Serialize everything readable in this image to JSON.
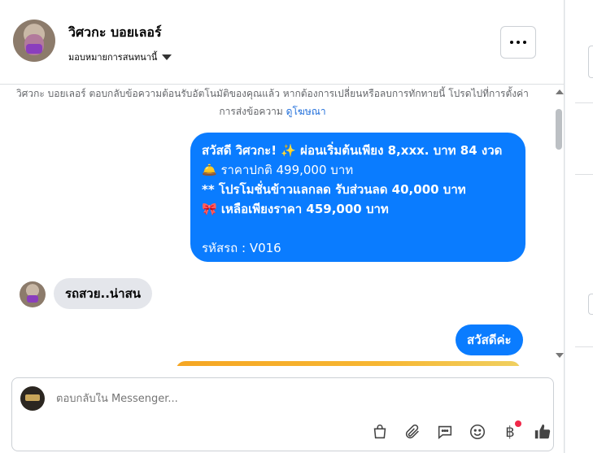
{
  "header": {
    "name": "วิศวกะ บอยเลอร์",
    "assign_label": "มอบหมายการสนทนานี้",
    "more_icon": "more-dots-icon"
  },
  "notice": {
    "text": "วิศวกะ บอยเลอร์ ตอบกลับข้อความต้อนรับอัตโนมัติของคุณแล้ว หากต้องการเปลี่ยนหรือลบการทักทายนี้ โปรดไปที่การตั้งค่าการส่งข้อความ",
    "link": "ดูโฆษณา"
  },
  "messages": {
    "outgoing_1": {
      "line1": "สวัสดี วิศวกะ! ✨  ผ่อนเริ่มต้นเพียง 8,xxx. บาท 84 งวด",
      "line2": "🛎️ ราคาปกติ 499,000 บาท",
      "line3": "** โปรโมชั่นข้าวแลกลด รับส่วนลด 40,000 บาท",
      "line4": "🎀  เหลือเพียงราคา 459,000 บาท",
      "line5": "",
      "line6": "รหัสรถ : V016"
    },
    "incoming_1": "รถสวย..น่าสน",
    "outgoing_2": "สวัสดีค่ะ"
  },
  "composer": {
    "placeholder": "ตอบกลับใน Messenger...",
    "tools": [
      "shopping-bag-icon",
      "paperclip-icon",
      "saved-reply-icon",
      "emoji-icon",
      "baht-payment-icon",
      "thumbs-up-icon"
    ],
    "baht_symbol": "฿"
  },
  "colors": {
    "accent": "#0a7cff",
    "incoming_bubble": "#e4e6eb",
    "link": "#216fdb",
    "notification": "#f02849"
  }
}
